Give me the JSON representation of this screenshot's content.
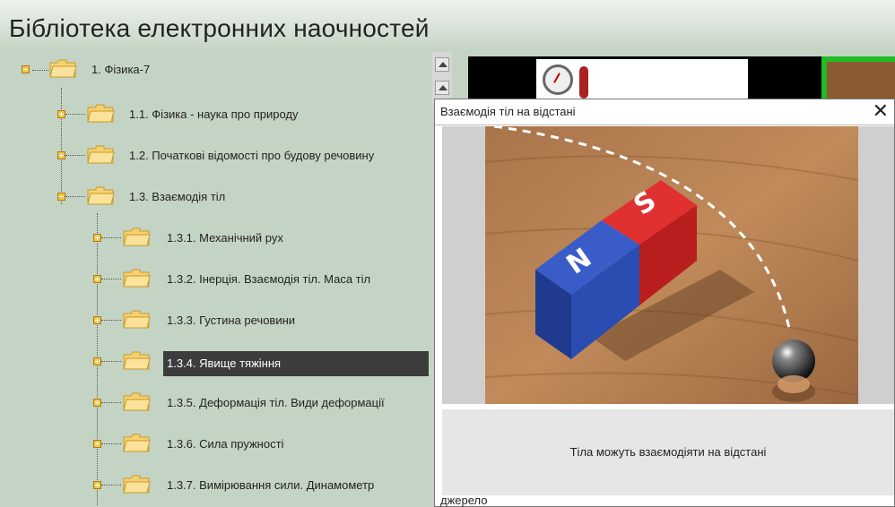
{
  "header": {
    "title": "Бібліотека електронних наочностей"
  },
  "tree": {
    "items": [
      {
        "label": "1. Фізика-7",
        "expanded": true
      },
      {
        "label": "1.1. Фізика - наука про природу",
        "expanded": false
      },
      {
        "label": "1.2. Початкові відомості про будову речовину",
        "expanded": false
      },
      {
        "label": "1.3. Взаємодія тіл",
        "expanded": true
      },
      {
        "label": "1.3.1. Механічний рух",
        "expanded": false
      },
      {
        "label": "1.3.2. Інерція. Взаємодія тіл. Маса тіл",
        "expanded": false
      },
      {
        "label": "1.3.3. Густина речовини",
        "expanded": false
      },
      {
        "label": "1.3.4. Явище тяжіння",
        "expanded": false,
        "selected": true
      },
      {
        "label": "1.3.5. Деформація тіл. Види деформації",
        "expanded": false
      },
      {
        "label": "1.3.6. Сила пружності",
        "expanded": false
      },
      {
        "label": "1.3.7. Вимірювання сили. Динамометр",
        "expanded": false
      }
    ]
  },
  "popup": {
    "title": "Взаємодія тіл на відстані",
    "close_label": "✕",
    "caption": "Тіла можуть взаємодіяти на відстані",
    "source_label": "джерело",
    "image": {
      "magnet_north": "N",
      "magnet_south": "S"
    }
  },
  "colors": {
    "accent_green": "#22bb22",
    "tree_bg": "#c4d4c4",
    "selection_bg": "#3c3c3c",
    "folder": "#f4c341"
  },
  "icons": {
    "folder": "folder-icon",
    "expander": "expander-icon",
    "close": "close-icon",
    "scroll_up": "scroll-up-icon"
  }
}
